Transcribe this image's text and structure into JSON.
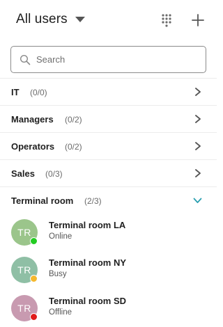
{
  "header": {
    "title": "All users",
    "dialpad_icon": "dialpad-icon",
    "add_icon": "plus-icon"
  },
  "search": {
    "placeholder": "Search",
    "value": ""
  },
  "groups": [
    {
      "name": "IT",
      "count": "(0/0)",
      "expanded": false
    },
    {
      "name": "Managers",
      "count": "(0/2)",
      "expanded": false
    },
    {
      "name": "Operators",
      "count": "(0/2)",
      "expanded": false
    },
    {
      "name": "Sales",
      "count": "(0/3)",
      "expanded": false
    },
    {
      "name": "Terminal room",
      "count": "(2/3)",
      "expanded": true
    }
  ],
  "users": [
    {
      "initials": "TR",
      "name": "Terminal room LA",
      "status": "Online",
      "avatar_color": "#9bc58b",
      "status_color": "#22cc22"
    },
    {
      "initials": "TR",
      "name": "Terminal room NY",
      "status": "Busy",
      "avatar_color": "#8fbfa5",
      "status_color": "#f5b82e"
    },
    {
      "initials": "TR",
      "name": "Terminal room SD",
      "status": "Offline",
      "avatar_color": "#c89ab0",
      "status_color": "#e01b1b"
    }
  ],
  "colors": {
    "accent": "#2a9fb0",
    "chevron": "#555555",
    "divider": "#ececec"
  }
}
